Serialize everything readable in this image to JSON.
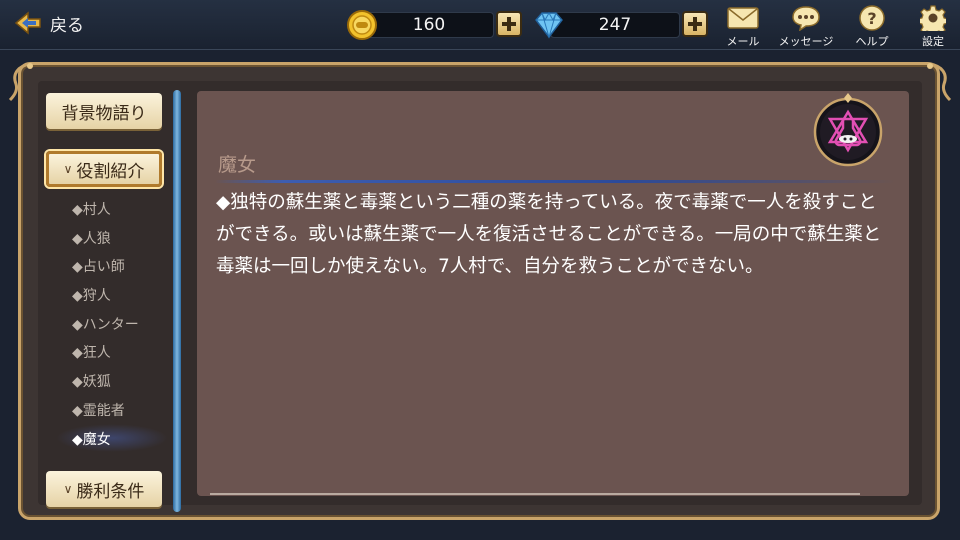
{
  "header": {
    "back_label": "戻る",
    "gold": "160",
    "gems": "247",
    "mail_label": "メール",
    "message_label": "メッセージ",
    "help_label": "ヘルプ",
    "settings_label": "設定"
  },
  "sidebar": {
    "background_story": "背景物語り",
    "role_intro": "役割紹介",
    "win_conditions": "勝利条件",
    "roles": [
      "◆村人",
      "◆人狼",
      "◆占い師",
      "◆狩人",
      "◆ハンター",
      "◆狂人",
      "◆妖狐",
      "◆霊能者",
      "◆魔女"
    ],
    "selected_index": 8
  },
  "content": {
    "role_name": "魔女",
    "description": "◆独特の蘇生薬と毒薬という二種の薬を持っている。夜で毒薬で一人を殺すことができる。或いは蘇生薬で一人を復活させることができる。一局の中で蘇生薬と毒薬は一回しか使えない。7人村で、自分を救うことができない。",
    "emblem_icon": "witch-potion-icon"
  },
  "colors": {
    "accent_gold": "#c9a46a",
    "panel": "#6b5450",
    "emblem_pink": "#e24fb3"
  }
}
